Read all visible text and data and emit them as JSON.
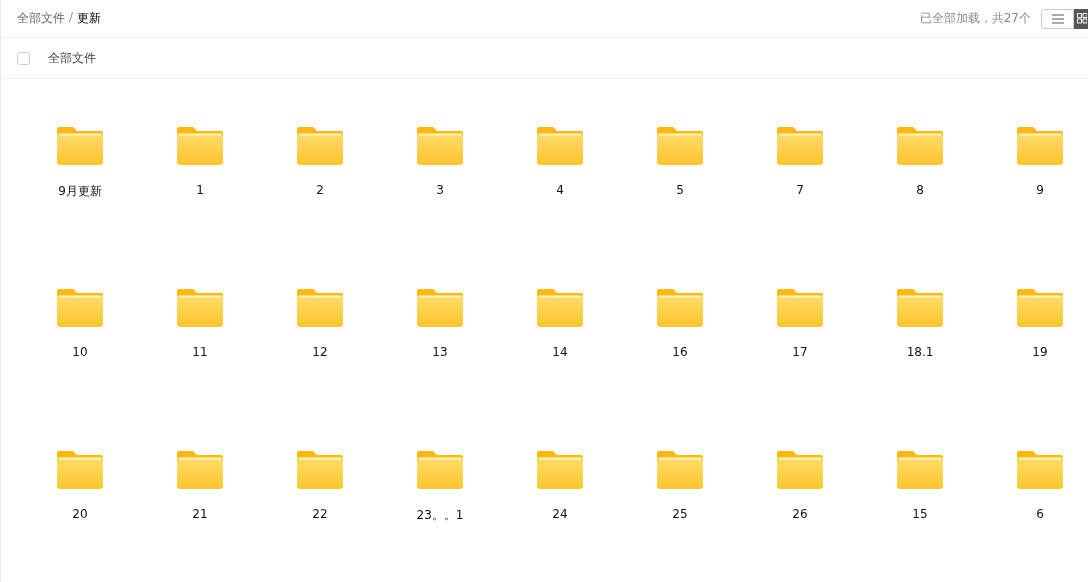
{
  "breadcrumb": {
    "parent": "全部文件",
    "separator": "/",
    "current": "更新"
  },
  "status": "已全部加载，共27个",
  "view_toggle": [
    {
      "kind": "list",
      "selected": false
    },
    {
      "kind": "grid",
      "selected": true
    }
  ],
  "select_all": {
    "label": "全部文件",
    "checked": false
  },
  "folders": [
    {
      "name": "9月更新"
    },
    {
      "name": "1"
    },
    {
      "name": "2"
    },
    {
      "name": "3"
    },
    {
      "name": "4"
    },
    {
      "name": "5"
    },
    {
      "name": "7"
    },
    {
      "name": "8"
    },
    {
      "name": "9"
    },
    {
      "name": "10"
    },
    {
      "name": "11"
    },
    {
      "name": "12"
    },
    {
      "name": "13"
    },
    {
      "name": "14"
    },
    {
      "name": "16"
    },
    {
      "name": "17"
    },
    {
      "name": "18.1"
    },
    {
      "name": "19"
    },
    {
      "name": "20"
    },
    {
      "name": "21"
    },
    {
      "name": "22"
    },
    {
      "name": "23。。1"
    },
    {
      "name": "24"
    },
    {
      "name": "25"
    },
    {
      "name": "26"
    },
    {
      "name": "15"
    },
    {
      "name": "6"
    }
  ]
}
